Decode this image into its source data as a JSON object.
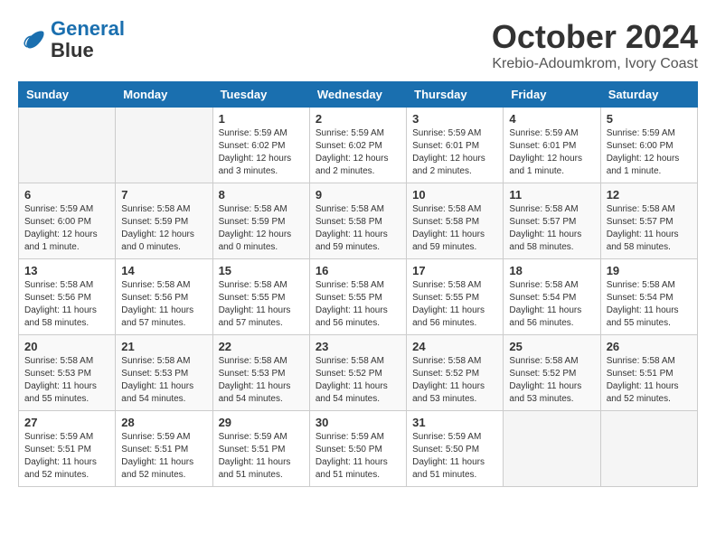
{
  "header": {
    "logo_line1": "General",
    "logo_line2": "Blue",
    "title": "October 2024",
    "subtitle": "Krebio-Adoumkrom, Ivory Coast"
  },
  "weekdays": [
    "Sunday",
    "Monday",
    "Tuesday",
    "Wednesday",
    "Thursday",
    "Friday",
    "Saturday"
  ],
  "weeks": [
    [
      {
        "day": "",
        "empty": true
      },
      {
        "day": "",
        "empty": true
      },
      {
        "day": "1",
        "info": "Sunrise: 5:59 AM\nSunset: 6:02 PM\nDaylight: 12 hours\nand 3 minutes."
      },
      {
        "day": "2",
        "info": "Sunrise: 5:59 AM\nSunset: 6:02 PM\nDaylight: 12 hours\nand 2 minutes."
      },
      {
        "day": "3",
        "info": "Sunrise: 5:59 AM\nSunset: 6:01 PM\nDaylight: 12 hours\nand 2 minutes."
      },
      {
        "day": "4",
        "info": "Sunrise: 5:59 AM\nSunset: 6:01 PM\nDaylight: 12 hours\nand 1 minute."
      },
      {
        "day": "5",
        "info": "Sunrise: 5:59 AM\nSunset: 6:00 PM\nDaylight: 12 hours\nand 1 minute."
      }
    ],
    [
      {
        "day": "6",
        "info": "Sunrise: 5:59 AM\nSunset: 6:00 PM\nDaylight: 12 hours\nand 1 minute."
      },
      {
        "day": "7",
        "info": "Sunrise: 5:58 AM\nSunset: 5:59 PM\nDaylight: 12 hours\nand 0 minutes."
      },
      {
        "day": "8",
        "info": "Sunrise: 5:58 AM\nSunset: 5:59 PM\nDaylight: 12 hours\nand 0 minutes."
      },
      {
        "day": "9",
        "info": "Sunrise: 5:58 AM\nSunset: 5:58 PM\nDaylight: 11 hours\nand 59 minutes."
      },
      {
        "day": "10",
        "info": "Sunrise: 5:58 AM\nSunset: 5:58 PM\nDaylight: 11 hours\nand 59 minutes."
      },
      {
        "day": "11",
        "info": "Sunrise: 5:58 AM\nSunset: 5:57 PM\nDaylight: 11 hours\nand 58 minutes."
      },
      {
        "day": "12",
        "info": "Sunrise: 5:58 AM\nSunset: 5:57 PM\nDaylight: 11 hours\nand 58 minutes."
      }
    ],
    [
      {
        "day": "13",
        "info": "Sunrise: 5:58 AM\nSunset: 5:56 PM\nDaylight: 11 hours\nand 58 minutes."
      },
      {
        "day": "14",
        "info": "Sunrise: 5:58 AM\nSunset: 5:56 PM\nDaylight: 11 hours\nand 57 minutes."
      },
      {
        "day": "15",
        "info": "Sunrise: 5:58 AM\nSunset: 5:55 PM\nDaylight: 11 hours\nand 57 minutes."
      },
      {
        "day": "16",
        "info": "Sunrise: 5:58 AM\nSunset: 5:55 PM\nDaylight: 11 hours\nand 56 minutes."
      },
      {
        "day": "17",
        "info": "Sunrise: 5:58 AM\nSunset: 5:55 PM\nDaylight: 11 hours\nand 56 minutes."
      },
      {
        "day": "18",
        "info": "Sunrise: 5:58 AM\nSunset: 5:54 PM\nDaylight: 11 hours\nand 56 minutes."
      },
      {
        "day": "19",
        "info": "Sunrise: 5:58 AM\nSunset: 5:54 PM\nDaylight: 11 hours\nand 55 minutes."
      }
    ],
    [
      {
        "day": "20",
        "info": "Sunrise: 5:58 AM\nSunset: 5:53 PM\nDaylight: 11 hours\nand 55 minutes."
      },
      {
        "day": "21",
        "info": "Sunrise: 5:58 AM\nSunset: 5:53 PM\nDaylight: 11 hours\nand 54 minutes."
      },
      {
        "day": "22",
        "info": "Sunrise: 5:58 AM\nSunset: 5:53 PM\nDaylight: 11 hours\nand 54 minutes."
      },
      {
        "day": "23",
        "info": "Sunrise: 5:58 AM\nSunset: 5:52 PM\nDaylight: 11 hours\nand 54 minutes."
      },
      {
        "day": "24",
        "info": "Sunrise: 5:58 AM\nSunset: 5:52 PM\nDaylight: 11 hours\nand 53 minutes."
      },
      {
        "day": "25",
        "info": "Sunrise: 5:58 AM\nSunset: 5:52 PM\nDaylight: 11 hours\nand 53 minutes."
      },
      {
        "day": "26",
        "info": "Sunrise: 5:58 AM\nSunset: 5:51 PM\nDaylight: 11 hours\nand 52 minutes."
      }
    ],
    [
      {
        "day": "27",
        "info": "Sunrise: 5:59 AM\nSunset: 5:51 PM\nDaylight: 11 hours\nand 52 minutes."
      },
      {
        "day": "28",
        "info": "Sunrise: 5:59 AM\nSunset: 5:51 PM\nDaylight: 11 hours\nand 52 minutes."
      },
      {
        "day": "29",
        "info": "Sunrise: 5:59 AM\nSunset: 5:51 PM\nDaylight: 11 hours\nand 51 minutes."
      },
      {
        "day": "30",
        "info": "Sunrise: 5:59 AM\nSunset: 5:50 PM\nDaylight: 11 hours\nand 51 minutes."
      },
      {
        "day": "31",
        "info": "Sunrise: 5:59 AM\nSunset: 5:50 PM\nDaylight: 11 hours\nand 51 minutes."
      },
      {
        "day": "",
        "empty": true
      },
      {
        "day": "",
        "empty": true
      }
    ]
  ]
}
